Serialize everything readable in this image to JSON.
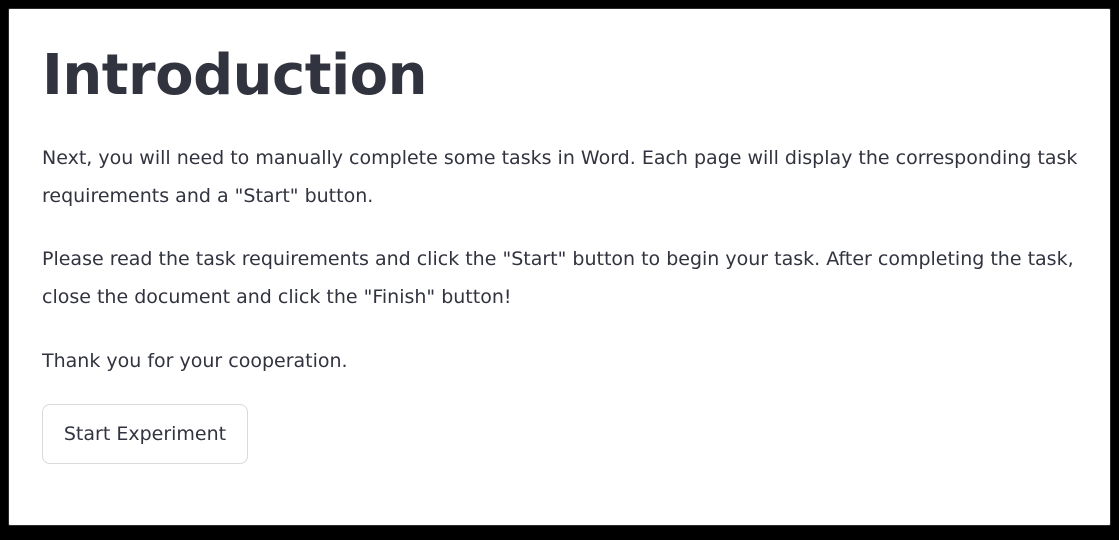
{
  "page": {
    "title": "Introduction",
    "paragraphs": [
      "Next, you will need to manually complete some tasks in Word. Each page will display the corresponding task requirements and a \"Start\" button.",
      "Please read the task requirements and click the \"Start\" button to begin your task. After completing the task, close the document and click the \"Finish\" button!",
      "Thank you for your cooperation."
    ],
    "start_button_label": "Start Experiment"
  },
  "colors": {
    "text": "#31333f",
    "background": "#ffffff",
    "button_border": "#d9d9de",
    "outer_frame": "#000000"
  }
}
